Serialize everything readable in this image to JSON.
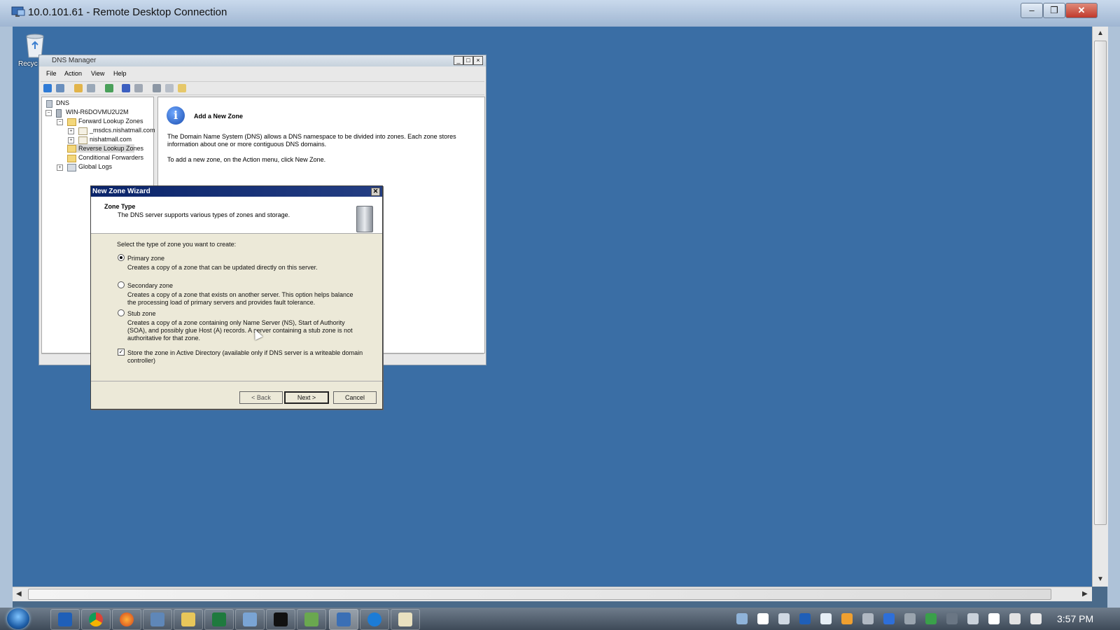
{
  "rdp": {
    "title": "10.0.101.61 - Remote Desktop Connection",
    "controls": [
      "‒",
      "❐",
      "✕"
    ]
  },
  "desktop": {
    "recycle_label": "Recyc"
  },
  "dns_manager": {
    "title": "DNS Manager",
    "menu": [
      "File",
      "Action",
      "View",
      "Help"
    ],
    "tree": {
      "root": "DNS",
      "server": "WIN-R6DOVMU2U2M",
      "forward": "Forward Lookup Zones",
      "zone1": "_msdcs.nishatmall.com",
      "zone2": "nishatmall.com",
      "reverse": "Reverse Lookup Zones",
      "conditional": "Conditional Forwarders",
      "global_logs": "Global Logs"
    },
    "content": {
      "heading": "Add a New Zone",
      "para1a": "The Domain Name System (DNS) allows a DNS namespace to be divided into zones. Each zone stores",
      "para1b": "information about one or more contiguous DNS domains.",
      "para2": "To add a new zone, on the Action menu, click New Zone."
    }
  },
  "wizard": {
    "title": "New Zone Wizard",
    "close": "✕",
    "header_title": "Zone Type",
    "header_subtitle": "The DNS server supports various types of zones and storage.",
    "prompt": "Select the type of zone you want to create:",
    "options": [
      {
        "label": "Primary zone",
        "desc1": "Creates a copy of a zone that can be updated directly on this server.",
        "desc2": "",
        "desc3": "",
        "selected": true
      },
      {
        "label": "Secondary zone",
        "desc1": "Creates a copy of a zone that exists on another server. This option helps balance",
        "desc2": "the processing load of primary servers and provides fault tolerance.",
        "desc3": "",
        "selected": false
      },
      {
        "label": "Stub zone",
        "desc1": "Creates a copy of a zone containing only Name Server (NS), Start of Authority",
        "desc2": "(SOA), and possibly glue Host (A) records. A server containing a stub zone is not",
        "desc3": "authoritative for that zone.",
        "selected": false
      }
    ],
    "ad_checkbox_line1": "Store the zone in Active Directory (available only if DNS server is a writeable domain",
    "ad_checkbox_line2": "controller)",
    "ad_checked": true,
    "buttons": {
      "back": "< Back",
      "next": "Next >",
      "cancel": "Cancel"
    }
  },
  "taskbar": {
    "time": "3:57 PM"
  }
}
